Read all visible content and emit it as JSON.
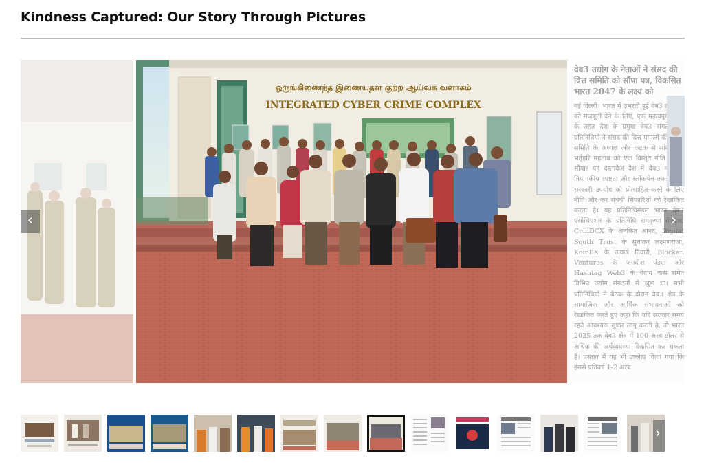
{
  "page": {
    "title": "Kindness Captured: Our Story Through Pictures"
  },
  "slider": {
    "prev_icon": "chevron-left-icon",
    "next_icon": "chevron-right-icon",
    "active_slide": {
      "sign_line_1": "ஒருங்கிணைந்த இணையதள குற்ற ஆய்வக வளாகம்",
      "sign_line_2": "INTEGRATED CYBER CRIME COMPLEX"
    },
    "next_slide_news": {
      "headline": "वेब3 उद्योग के नेताओं ने संसद की वित्त समिति को सौंपा पत्र, विकसित भारत 2047 के लक्ष्य को",
      "body": "नई दिल्ली। भारत में उभरती हुई वेब3 तकनीक को मजबूती देने के लिए, एक महत्वपूर्ण पहल के तहत देश के प्रमुख वेब3 संगठनों के प्रतिनिधियों ने संसद की वित्त मामलों की स्थायी समिति के अध्यक्ष और कटक से सांसद डॉ. भर्तृहरि महताब को एक विस्तृत नीति प्रस्ताव सौंपा। यह दस्तावेज देश में वेब3 नवाचार, नियामकीय स्पष्टता और ब्लॉकचेन तकनीक के सरकारी उपयोग को प्रोत्साहित करने के लिए नीति और कर संबंधी सिफारिशों को रेखांकित करता है। यह प्रतिनिधिमंडल भारत वेब3 एसोसिएशन के प्रतिनिधि रामकृष्ण वेंकटेश, CoinDCX के अनकित आनंद, Digital South Trust के सुधाकर लक्ष्मणराजा, KoinBX के उत्कर्ष तिवारी, Blockan Ventures के जगदीश पंड्या और Hashtag Web3 के वेदांग वत्स समेत विभिन्न उद्योग संगठनों से जुड़ा था। सभी प्रतिनिधियों ने बैठक के दौरान वेब3 क्षेत्र के सामाजिक और आर्थिक संभावनाओं को रेखांकित करते हुए कहा कि यदि सरकार समय रहते आवश्यक सुधार लागू करती है, तो भारत 2035 तक वेब3 क्षेत्र में 100 अरब डॉलर से अधिक की अर्थव्यवस्था विकसित कर सकता है। प्रस्ताव में यह भी उल्लेख किया गया कि इससे प्रतिवर्ष 1-2 अरब"
    }
  },
  "thumbnails": [
    {
      "label": "thumb-1"
    },
    {
      "label": "thumb-2"
    },
    {
      "label": "thumb-3"
    },
    {
      "label": "thumb-4"
    },
    {
      "label": "thumb-5"
    },
    {
      "label": "thumb-6"
    },
    {
      "label": "thumb-7"
    },
    {
      "label": "thumb-8"
    },
    {
      "label": "thumb-9"
    },
    {
      "label": "thumb-10"
    },
    {
      "label": "thumb-11"
    },
    {
      "label": "thumb-12"
    },
    {
      "label": "thumb-13"
    },
    {
      "label": "thumb-14"
    },
    {
      "label": "thumb-15"
    }
  ],
  "thumb_active_index": 8,
  "thumb_next_icon": "chevron-right-icon"
}
